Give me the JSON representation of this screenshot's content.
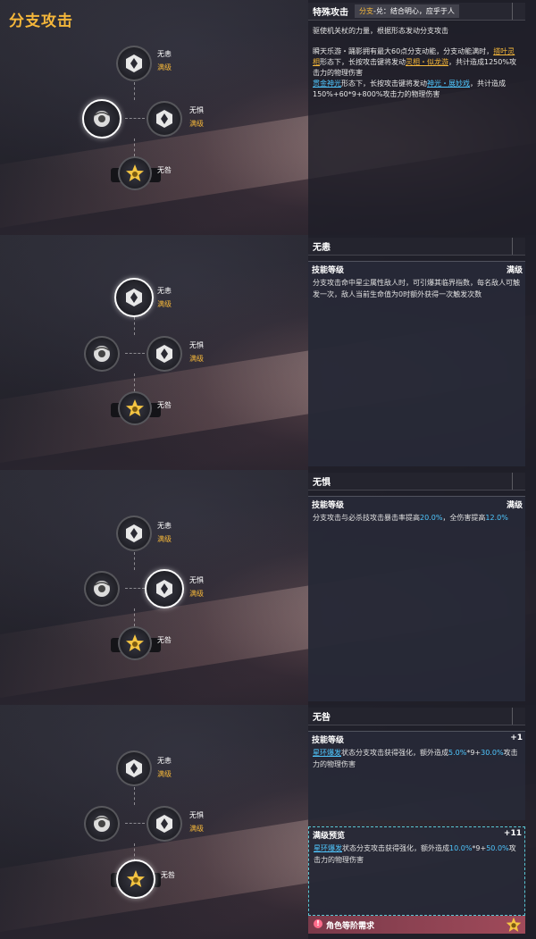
{
  "app": {
    "title": "分支攻击"
  },
  "tree": {
    "node_a": {
      "name": "无恚",
      "status": "满级"
    },
    "node_b": {
      "name": "无惧",
      "status": "满级"
    },
    "node_c": {
      "name": "无咎"
    }
  },
  "panel1": {
    "header_title": "特殊攻击",
    "tag_prefix": "分支",
    "tag_rest": "-兑：结合明心，应乎于人",
    "line1": "驱使机关杖的力量，根据形态发动分支攻击",
    "p_a1": "瞬天乐游・踊影拥有最大60点分支动能，分支动能满时，",
    "p_a2": "搭叶灵相",
    "p_a3": "形态下，长按攻击键将发动",
    "p_a4": "灵相・似龙游",
    "p_a5": "，共计造成1250%攻击力的物理伤害",
    "p_b1": "贯金神光",
    "p_b2": "形态下，长按攻击键将发动",
    "p_b3": "神光・展妙戏",
    "p_b4": "，共计造成150%+60*9+800%攻击力的物理伤害"
  },
  "panel2": {
    "header_title": "无恚",
    "box_title": "技能等级",
    "box_right": "满级",
    "body": "分支攻击命中星尘属性敌人时，可引爆其临界指数，每名敌人可触发一次，敌人当前生命值为0时额外获得一次触发次数"
  },
  "panel3": {
    "header_title": "无惧",
    "box_title": "技能等级",
    "box_right": "满级",
    "body1": "分支攻击与必杀技攻击暴击率提高",
    "v1": "20.0%",
    "body2": "，全伤害提高",
    "v2": "12.0%"
  },
  "panel4": {
    "header_title": "无咎",
    "box1_title": "技能等级",
    "box1_right": "+1",
    "b1_link": "星环爆发",
    "b1_text1": "状态分支攻击获得强化，额外造成",
    "b1_v1": "5.0%",
    "b1_mid": "*9+",
    "b1_v2": "30.0%",
    "b1_text2": "攻击力的物理伤害",
    "box2_title": "满级预览",
    "box2_right": "+11",
    "b2_link": "星环爆发",
    "b2_text1": "状态分支攻击获得强化，额外造成",
    "b2_v1": "10.0%",
    "b2_mid": "*9+",
    "b2_v2": "50.0%",
    "b2_text2": "攻击力的物理伤害",
    "req_icon": "!",
    "req_text": "角色等阶需求"
  }
}
